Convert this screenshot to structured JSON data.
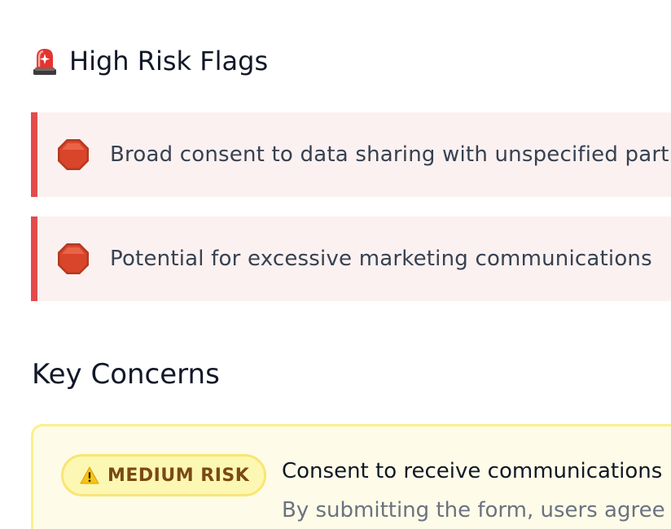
{
  "high_risk_flags": {
    "title": "High Risk Flags",
    "title_icon": "siren-icon",
    "item_icon": "stop-sign-icon",
    "items": [
      {
        "text": "Broad consent to data sharing with unspecified partners"
      },
      {
        "text": "Potential for excessive marketing communications"
      }
    ],
    "colors": {
      "card_background": "#fbf1f0",
      "card_border": "#e34b4b"
    }
  },
  "key_concerns": {
    "title": "Key Concerns",
    "items": [
      {
        "risk_level": "MEDIUM RISK",
        "risk_icon": "warning-icon",
        "title": "Consent to receive communications",
        "description": "By submitting the form, users agree to"
      }
    ],
    "colors": {
      "card_background": "#fefce8",
      "card_border": "#fbf08c",
      "badge_background": "#fdf7b4",
      "badge_text": "#7a4a12"
    }
  }
}
